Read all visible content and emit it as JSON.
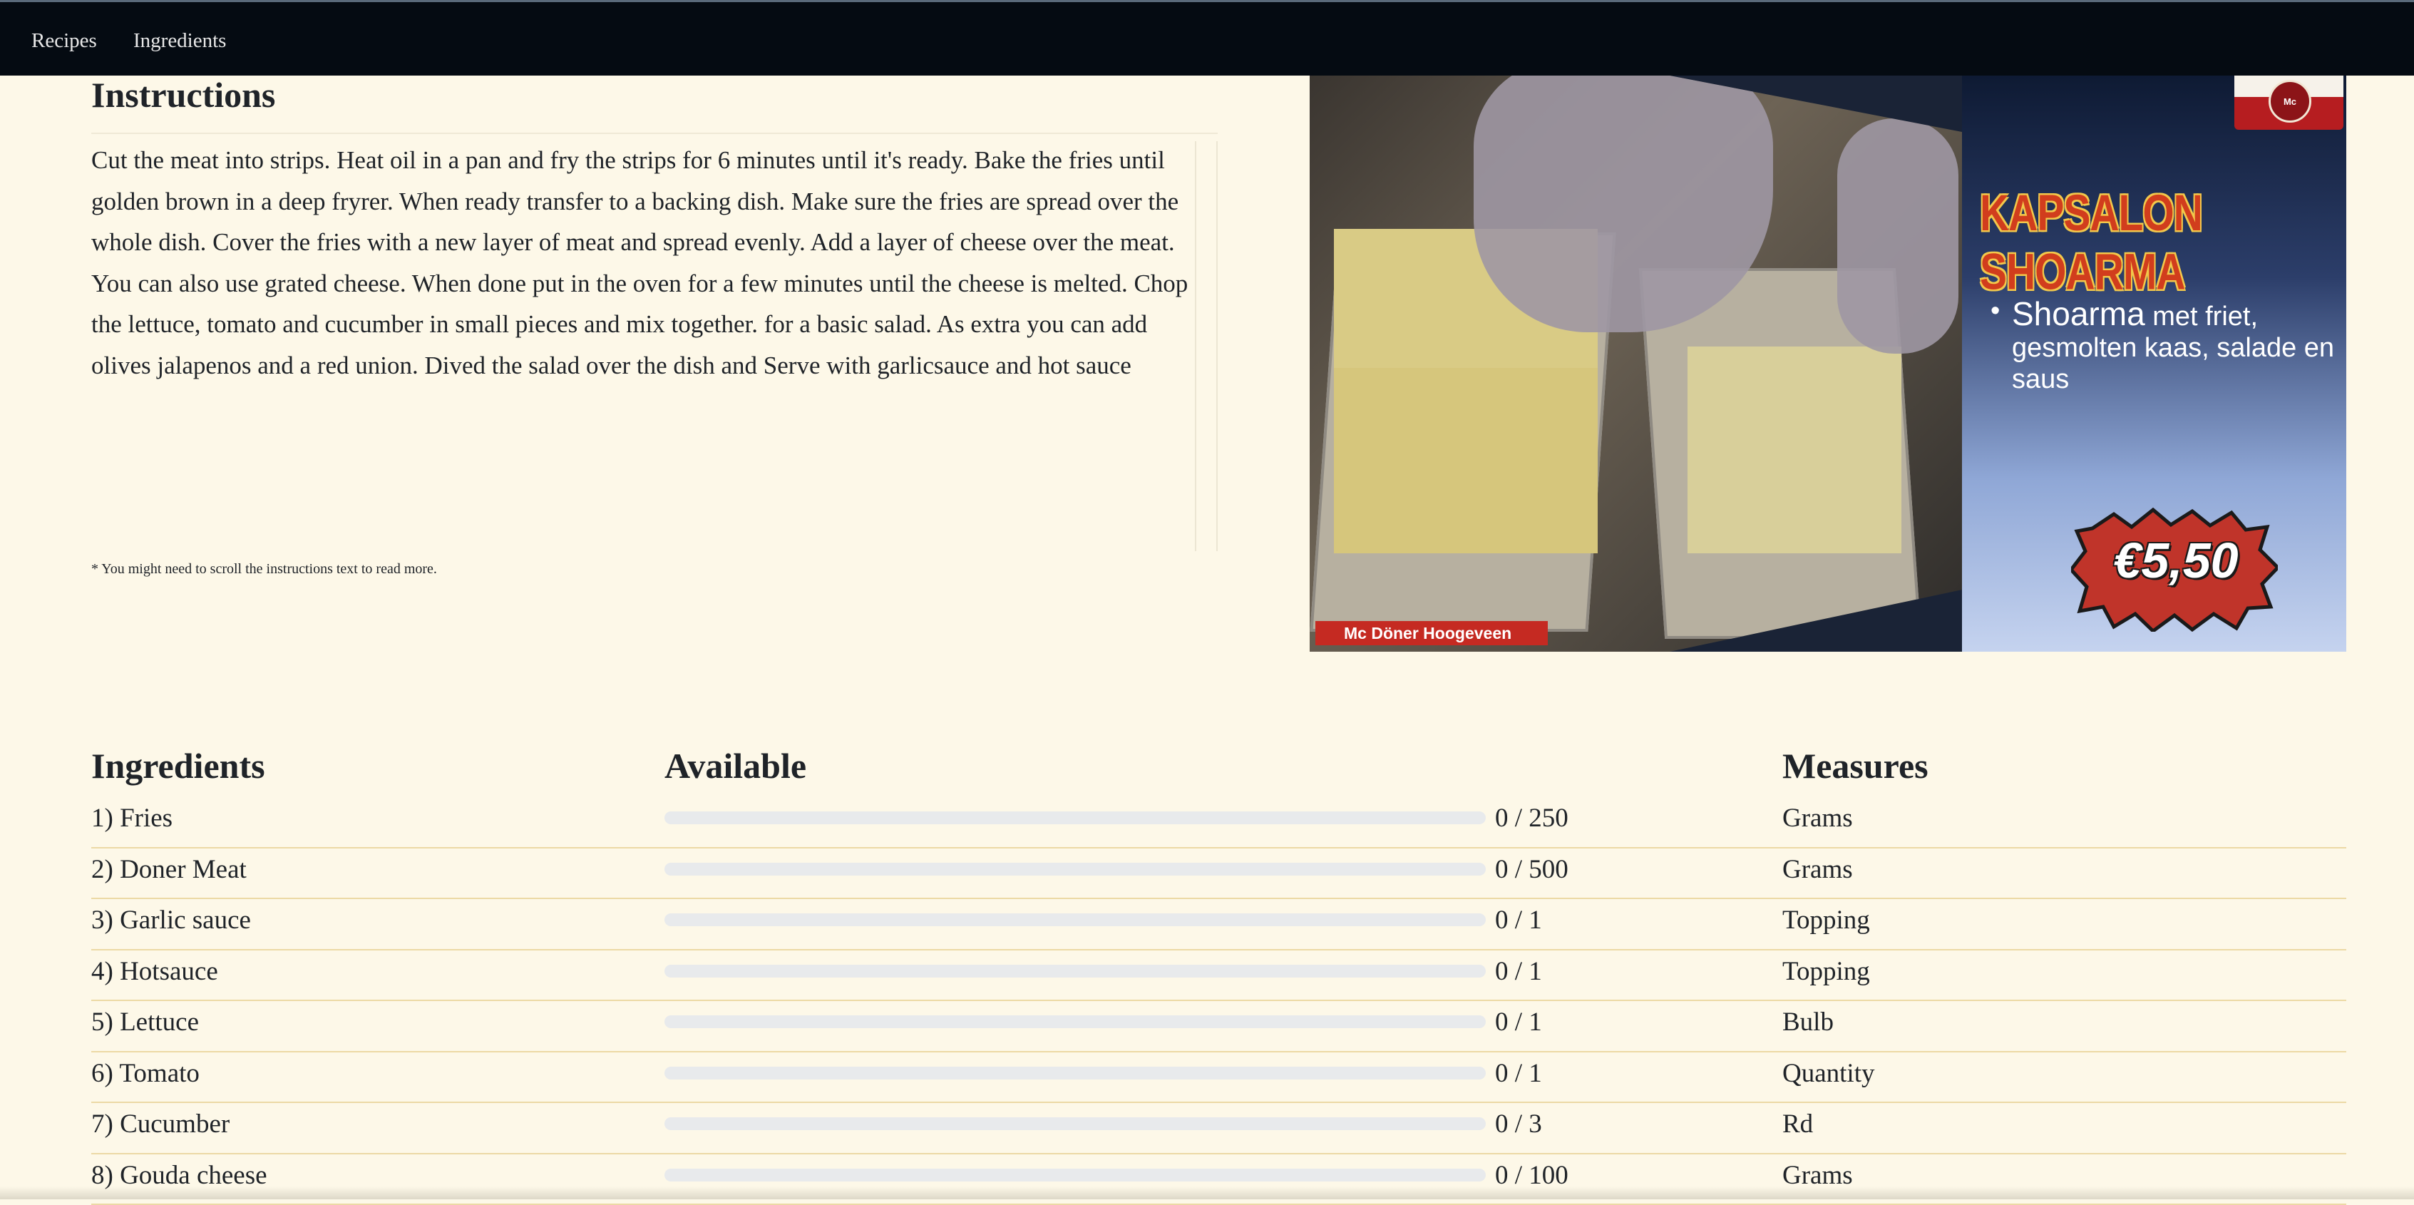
{
  "nav": {
    "recipes": "Recipes",
    "ingredients": "Ingredients"
  },
  "instructions": {
    "title": "Instructions",
    "text": "Cut the meat into strips. Heat oil in a pan and fry the strips for 6 minutes until it's ready. Bake the fries until golden brown in a deep fryrer. When ready transfer to a backing dish. Make sure the fries are spread over the whole dish. Cover the fries with a new layer of meat and spread evenly. Add a layer of cheese over the meat. You can also use grated cheese. When done put in the oven for a few minutes until the cheese is melted. Chop the lettuce, tomato and cucumber in small pieces and mix together. for a basic salad. As extra you can add olives jalapenos and a red union. Dived the salad over the dish and Serve with garlicsauce and hot sauce",
    "scroll_note": "* You might need to scroll the instructions text to read more."
  },
  "ad": {
    "logo_text": "Mc Döner",
    "headline": "KAPSALON SHOARMA",
    "desc_big": "Shoarma",
    "desc_rest": "met friet, gesmolten kaas, salade en saus",
    "price": "€5,50",
    "caption": "Mc Döner Hoogeveen"
  },
  "ingredients_table": {
    "headers": {
      "ingredients": "Ingredients",
      "available": "Available",
      "measures": "Measures"
    },
    "rows": [
      {
        "name": "1) Fries",
        "available": 0,
        "total": 250,
        "amount": "0 / 250",
        "measure": "Grams"
      },
      {
        "name": "2) Doner Meat",
        "available": 0,
        "total": 500,
        "amount": "0 / 500",
        "measure": "Grams"
      },
      {
        "name": "3) Garlic sauce",
        "available": 0,
        "total": 1,
        "amount": "0 / 1",
        "measure": "Topping"
      },
      {
        "name": "4) Hotsauce",
        "available": 0,
        "total": 1,
        "amount": "0 / 1",
        "measure": "Topping"
      },
      {
        "name": "5) Lettuce",
        "available": 0,
        "total": 1,
        "amount": "0 / 1",
        "measure": "Bulb"
      },
      {
        "name": "6) Tomato",
        "available": 0,
        "total": 1,
        "amount": "0 / 1",
        "measure": "Quantity"
      },
      {
        "name": "7) Cucumber",
        "available": 0,
        "total": 3,
        "amount": "0 / 3",
        "measure": "Rd"
      },
      {
        "name": "8) Gouda cheese",
        "available": 0,
        "total": 100,
        "amount": "0 / 100",
        "measure": "Grams"
      }
    ]
  },
  "colors": {
    "navbar": "#050b12",
    "page_background": "#fdf8e8",
    "row_divider": "#ecd9a5",
    "progress_track": "#e8eaec",
    "price_badge": "#c0342a"
  }
}
